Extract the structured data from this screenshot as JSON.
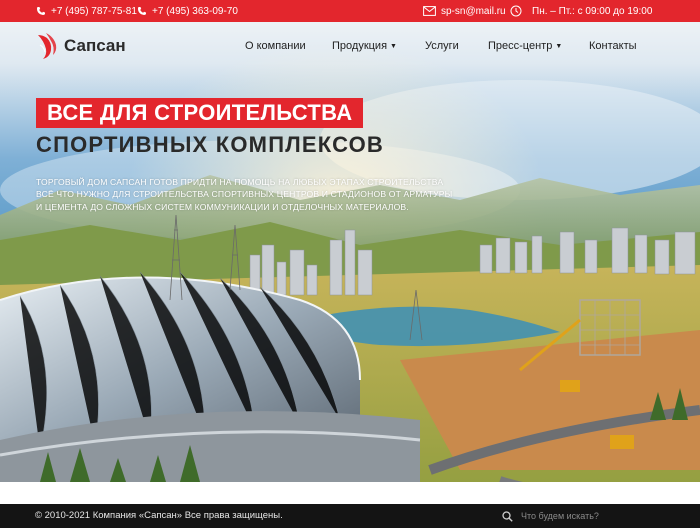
{
  "topbar": {
    "phone1": "+7 (495) 787-75-81",
    "phone2": "+7 (495) 363-09-70",
    "email": "sp-sn@mail.ru",
    "hours": "Пн. – Пт.: с 09:00 до 19:00"
  },
  "logo": {
    "name": "Сапсан"
  },
  "nav": {
    "items": [
      {
        "label": "О компании"
      },
      {
        "label": "Продукция",
        "dropdown": true
      },
      {
        "label": "Услуги"
      },
      {
        "label": "Пресс-центр",
        "dropdown": true
      },
      {
        "label": "Контакты"
      }
    ]
  },
  "hero": {
    "line1": "ВСЕ ДЛЯ СТРОИТЕЛЬСТВА",
    "line2": "СПОРТИВНЫХ КОМПЛЕКСОВ",
    "description": "Торговый дом Сапсан готов придти на помощь на любых этапах строительства всё что нужно для строительства спортивных центров и стадионов от арматуры и цемента до сложных систем коммуникации и отделочных материалов."
  },
  "footer": {
    "copyright": "© 2010-2021 Компания «Сапсан» Все права защищены.",
    "search_placeholder": "Что будем искать?"
  },
  "colors": {
    "accent": "#e3262d",
    "footer_bg": "#141414"
  },
  "icons": [
    "phone-icon",
    "mail-icon",
    "clock-icon",
    "search-icon",
    "falcon-logo-icon"
  ]
}
